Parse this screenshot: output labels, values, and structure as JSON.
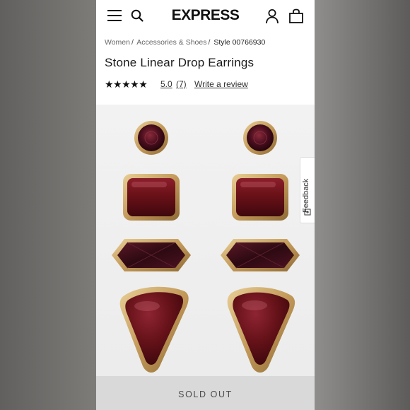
{
  "header": {
    "logo": "EXPRESS",
    "menu_icon": "hamburger-menu-icon",
    "search_icon": "search-icon",
    "account_icon": "user-icon",
    "bag_icon": "shopping-bag-icon"
  },
  "breadcrumb": {
    "items": [
      "Women",
      "Accessories & Shoes"
    ],
    "style_label": "Style 00766930"
  },
  "product": {
    "title": "Stone Linear Drop Earrings",
    "stars": "★★★★★",
    "rating": 5.0,
    "rating_text": "5.0",
    "review_count": "(7)",
    "write_review": "Write a review",
    "stone_color": "#5c1219",
    "gold_color": "#c9a366"
  },
  "feedback": {
    "label": "Feedback",
    "icon": "feedback-icon"
  },
  "cta": {
    "label": "SOLD OUT"
  }
}
